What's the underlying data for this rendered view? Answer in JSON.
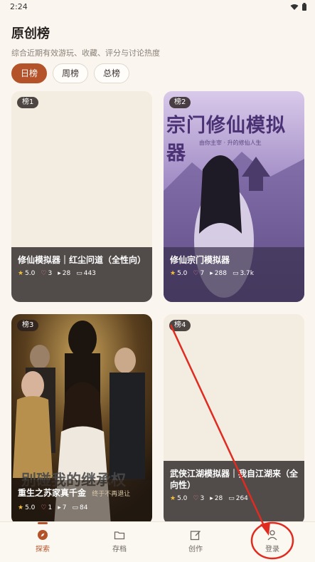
{
  "status_bar": {
    "time": "2:24",
    "icons": [
      "wifi-icon",
      "battery-icon"
    ]
  },
  "page": {
    "title": "原创榜",
    "subtitle": "综合近期有效游玩、收藏、评分与讨论热度"
  },
  "tabs": [
    {
      "label": "日榜",
      "active": true
    },
    {
      "label": "周榜",
      "active": false
    },
    {
      "label": "总榜",
      "active": false
    }
  ],
  "cards": [
    {
      "rank": "榜1",
      "name": "修仙模拟器｜红尘问道（全性向）",
      "rating": "5.0",
      "likes": "3",
      "plays": "28",
      "comments": "443"
    },
    {
      "rank": "榜2",
      "name": "修仙宗门模拟器",
      "rating": "5.0",
      "likes": "7",
      "plays": "288",
      "comments": "3.7k",
      "cover_title": "宗门修仙模拟器",
      "cover_tagline": "由你主宰 · 升的修仙人生"
    },
    {
      "rank": "榜3",
      "name": "重生之苏家真千金",
      "rating": "5.0",
      "likes": "1",
      "plays": "7",
      "comments": "84",
      "cover_title": "别碰我的继承权",
      "cover_tagline": "终于不再退让"
    },
    {
      "rank": "榜4",
      "name": "武侠江湖模拟器｜我自江湖来（全向性）",
      "rating": "5.0",
      "likes": "3",
      "plays": "28",
      "comments": "264"
    }
  ],
  "bottom_nav": [
    {
      "label": "探索",
      "icon": "compass-icon",
      "active": true
    },
    {
      "label": "存档",
      "icon": "folder-icon",
      "active": false
    },
    {
      "label": "创作",
      "icon": "edit-icon",
      "active": false
    },
    {
      "label": "登录",
      "icon": "user-icon",
      "active": false
    }
  ],
  "colors": {
    "accent": "#b4532a",
    "annotation": "#e02b20",
    "background": "#faf5ee"
  }
}
